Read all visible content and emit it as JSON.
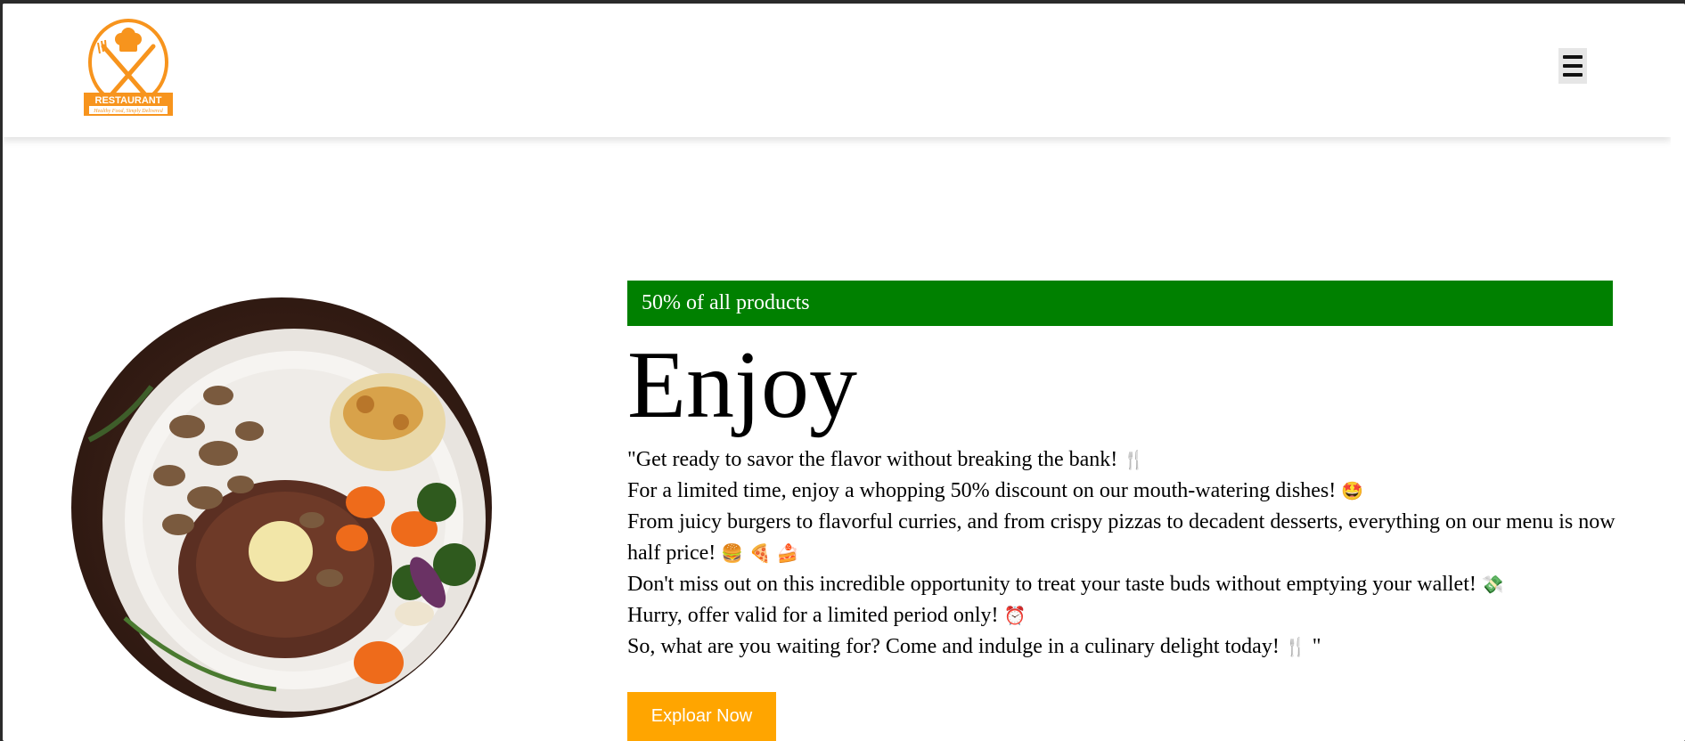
{
  "header": {
    "logo": {
      "text": "RESTAURANT",
      "tagline": "Healthy Food, Simply Delivered",
      "color": "#f7941d"
    },
    "menu_icon": "hamburger-menu-icon"
  },
  "hero": {
    "promo": "50% of all products",
    "promo_color": "#008000",
    "title": "Enjoy",
    "lines": [
      {
        "text": "\"Get ready to savor the flavor without breaking the bank!",
        "emoji": "🍴"
      },
      {
        "text": "For a limited time, enjoy a whopping 50% discount on our mouth-watering dishes!",
        "emoji": "🤩"
      },
      {
        "text": "From juicy burgers to flavorful curries, and from crispy pizzas to decadent desserts, everything on our menu is now half price!",
        "emoji": "🍔 🍕 🍰"
      },
      {
        "text": "Don't miss out on this incredible opportunity to treat your taste buds without emptying your wallet!",
        "emoji": "💸"
      },
      {
        "text": "Hurry, offer valid for a limited period only!",
        "emoji": "⏰"
      },
      {
        "text": "So, what are you waiting for? Come and indulge in a culinary delight today!",
        "emoji": "🍴",
        "suffix": " \""
      }
    ],
    "cta_label": "Exploar Now",
    "cta_color": "#ffa500",
    "image_alt": "steak-dish-image"
  }
}
